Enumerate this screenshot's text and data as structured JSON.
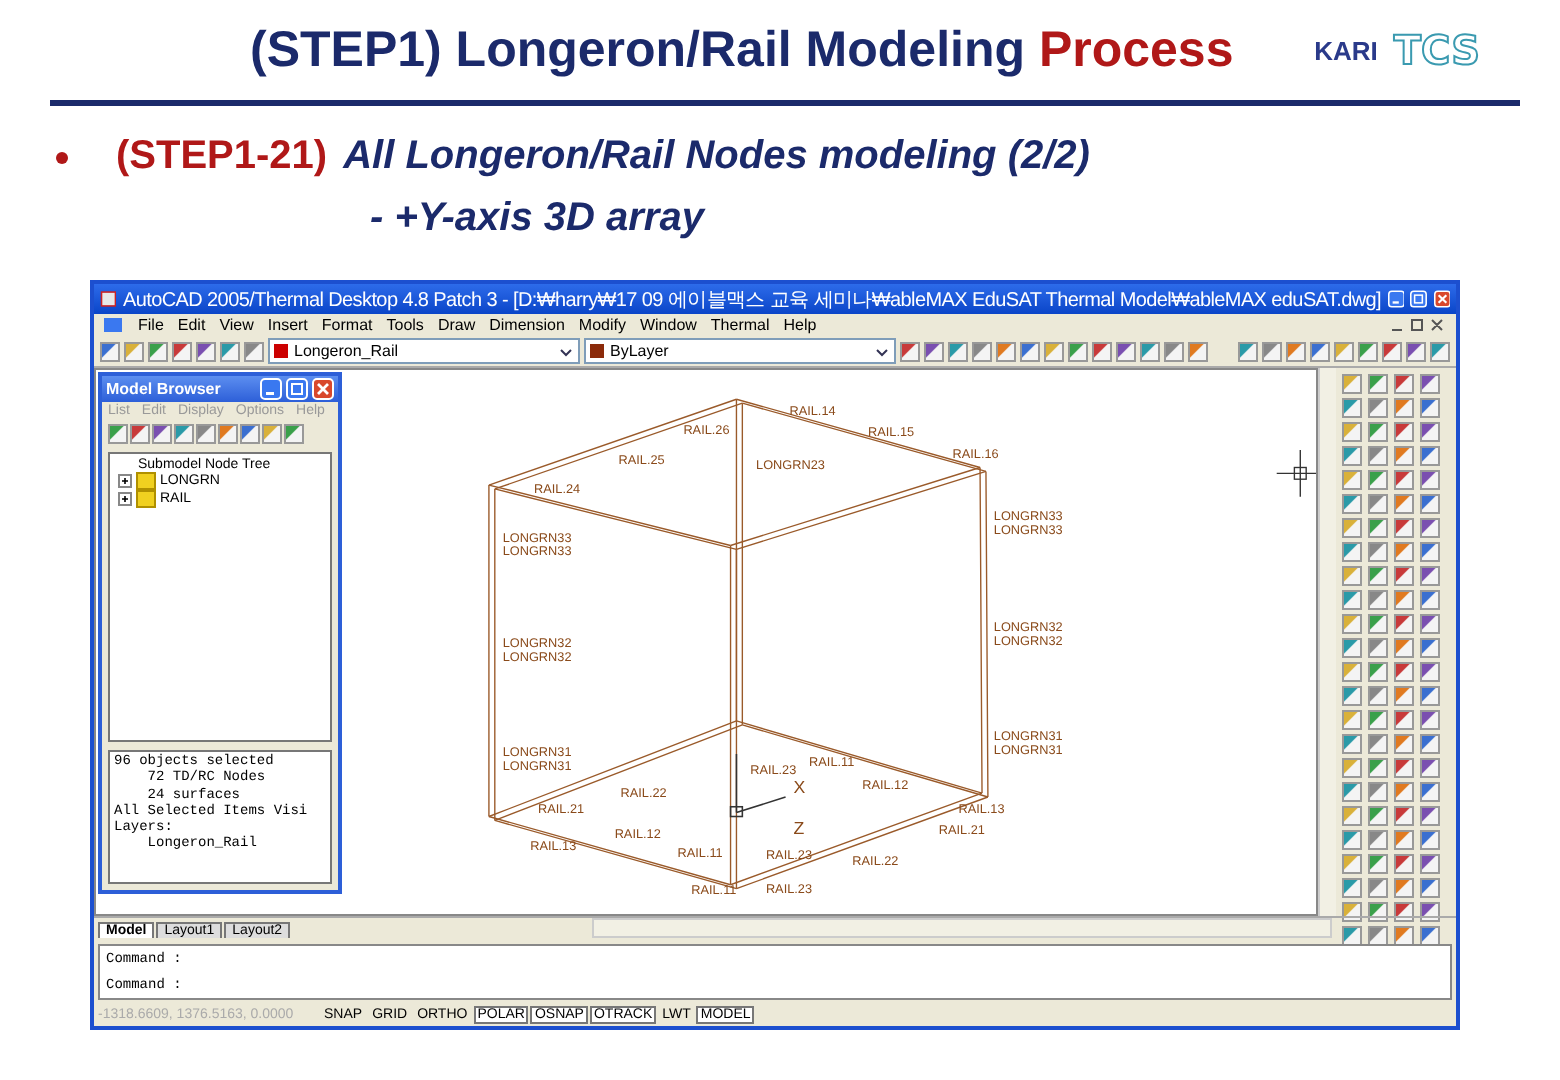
{
  "slide": {
    "title": "(STEP1) Longeron/Rail Modeling",
    "title_highlight": "Process",
    "logos": [
      "KARI",
      "TCS"
    ]
  },
  "bullet": {
    "step": "(STEP1-21)",
    "text": "All Longeron/Rail Nodes modeling (2/2)",
    "subtext": "- +Y-axis 3D array"
  },
  "app_window": {
    "title": "AutoCAD 2005/Thermal Desktop 4.8 Patch 3 - [D:₩harry₩17 09 에이블맥스 교육 세미나₩ableMAX EduSAT Thermal Model₩ableMAX eduSAT.dwg]",
    "menus": [
      "File",
      "Edit",
      "View",
      "Insert",
      "Format",
      "Tools",
      "Draw",
      "Dimension",
      "Modify",
      "Window",
      "Thermal",
      "Help"
    ],
    "layer": "Longeron_Rail",
    "color_setting": "ByLayer"
  },
  "model_browser": {
    "title": "Model Browser",
    "menus": [
      "List",
      "Edit",
      "Display",
      "Options",
      "Help"
    ],
    "tree_heading": "Submodel Node Tree",
    "nodes": [
      {
        "label": "LONGRN",
        "expanded": false
      },
      {
        "label": "RAIL",
        "expanded": false
      }
    ],
    "info_lines": [
      "96 objects selected",
      "    72 TD/RC Nodes",
      "    24 surfaces",
      "All Selected Items Visi",
      "Layers:",
      "    Longeron_Rail"
    ]
  },
  "drawing": {
    "node_labels": [
      "RAIL.14",
      "RAIL.15",
      "RAIL.16",
      "RAIL.26",
      "RAIL.25",
      "RAIL.24",
      "LONGRN33",
      "LONGRN33",
      "LONGRN33",
      "LONGRN33",
      "LONGRN23",
      "LONGRN32",
      "LONGRN32",
      "LONGRN32",
      "LONGRN32",
      "LONGRN31",
      "LONGRN31",
      "LONGRN31",
      "LONGRN31",
      "RAIL.23",
      "RAIL.11",
      "RAIL.22",
      "RAIL.12",
      "RAIL.13",
      "RAIL.21",
      "RAIL.13",
      "RAIL.12",
      "RAIL.22",
      "RAIL.21",
      "RAIL.11",
      "RAIL.23",
      "RAIL.11",
      "RAIL.23"
    ],
    "axis_labels": [
      "X",
      "Z"
    ]
  },
  "layout_tabs": [
    {
      "label": "Model",
      "selected": true
    },
    {
      "label": "Layout1",
      "selected": false
    },
    {
      "label": "Layout2",
      "selected": false
    }
  ],
  "command_lines": [
    "Command :",
    "Command :"
  ],
  "status_bar": {
    "coordinates": "-1318.6609, 1376.5163, 0.0000",
    "toggles": [
      {
        "label": "SNAP",
        "on": false
      },
      {
        "label": "GRID",
        "on": false
      },
      {
        "label": "ORTHO",
        "on": false
      },
      {
        "label": "POLAR",
        "on": true
      },
      {
        "label": "OSNAP",
        "on": true
      },
      {
        "label": "OTRACK",
        "on": true
      },
      {
        "label": "LWT",
        "on": false
      },
      {
        "label": "MODEL",
        "on": true
      }
    ]
  }
}
